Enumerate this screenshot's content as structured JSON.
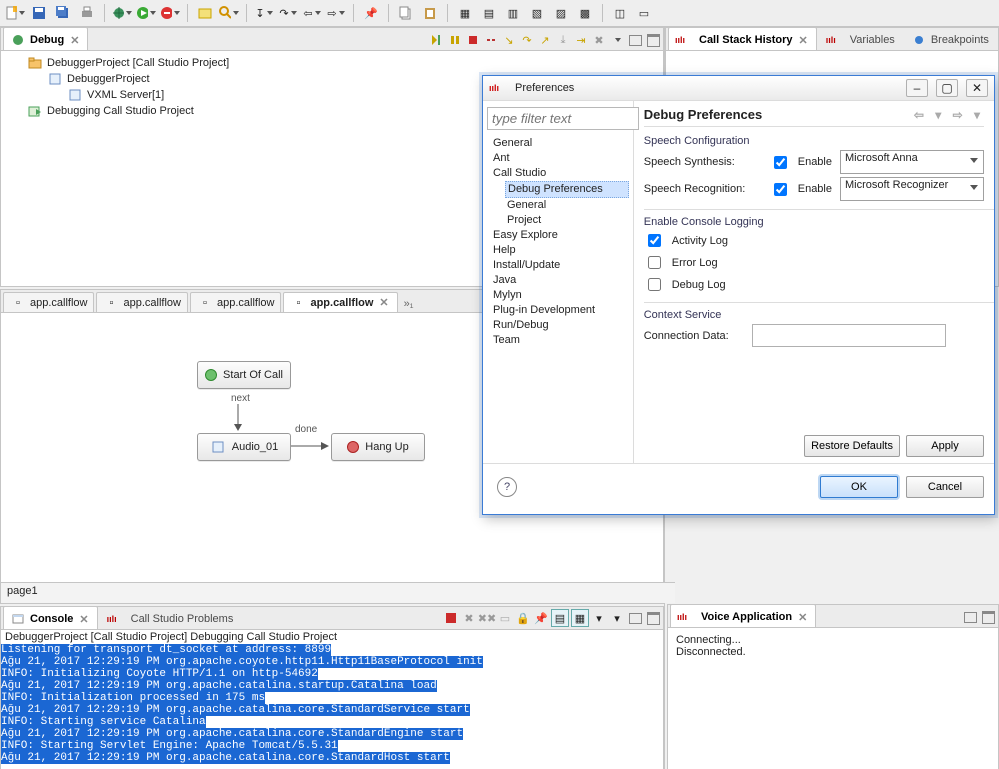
{
  "toolbar": {},
  "debugView": {
    "tab": "Debug",
    "tree": {
      "project": "DebuggerProject [Call Studio Project]",
      "app": "DebuggerProject",
      "server": "VXML Server[1]",
      "debugging": "Debugging Call Studio Project"
    }
  },
  "rightTabs": {
    "stack": "Call Stack History",
    "vars": "Variables",
    "bp": "Breakpoints"
  },
  "editors": {
    "t1": "app.callflow",
    "t2": "app.callflow",
    "t3": "app.callflow",
    "t4": "app.callflow",
    "overflow": "»₁"
  },
  "flow": {
    "start": "Start Of Call",
    "nextLbl": "next",
    "audio": "Audio_01",
    "doneLbl": "done",
    "hang": "Hang Up",
    "page": "page1"
  },
  "bottomTabs": {
    "console": "Console",
    "problems": "Call Studio Problems"
  },
  "console": {
    "header": "DebuggerProject [Call Studio Project] Debugging Call Studio Project",
    "l1": "Listening for transport dt_socket at address: 8899",
    "l2": "Ağu 21, 2017 12:29:19 PM org.apache.coyote.http11.Http11BaseProtocol init",
    "l3": "INFO: Initializing Coyote HTTP/1.1 on http-54692",
    "l4": "Ağu 21, 2017 12:29:19 PM org.apache.catalina.startup.Catalina load",
    "l5": "INFO: Initialization processed in 175 ms",
    "l6": "Ağu 21, 2017 12:29:19 PM org.apache.catalina.core.StandardService start",
    "l7": "INFO: Starting service Catalina",
    "l8": "Ağu 21, 2017 12:29:19 PM org.apache.catalina.core.StandardEngine start",
    "l9": "INFO: Starting Servlet Engine: Apache Tomcat/5.5.31",
    "l10": "Ağu 21, 2017 12:29:19 PM org.apache.catalina.core.StandardHost start"
  },
  "voice": {
    "tab": "Voice Application",
    "l1": "Connecting...",
    "l2": "Disconnected."
  },
  "dialog": {
    "title": "Preferences",
    "filterPlaceholder": "type filter text",
    "tree": {
      "general": "General",
      "ant": "Ant",
      "callstudio": "Call Studio",
      "debugprefs": "Debug Preferences",
      "general2": "General",
      "project": "Project",
      "easy": "Easy Explore",
      "help": "Help",
      "install": "Install/Update",
      "java": "Java",
      "mylyn": "Mylyn",
      "plugin": "Plug-in Development",
      "rundebug": "Run/Debug",
      "team": "Team"
    },
    "heading": "Debug Preferences",
    "speechGroup": "Speech Configuration",
    "synLbl": "Speech Synthesis:",
    "recogLbl": "Speech Recognition:",
    "enableLbl": "Enable",
    "synVal": "Microsoft Anna",
    "recogVal": "Microsoft Recognizer",
    "logGroup": "Enable Console Logging",
    "activity": "Activity Log",
    "errorlog": "Error Log",
    "debuglog": "Debug Log",
    "ctxGroup": "Context Service",
    "connLbl": "Connection Data:",
    "restore": "Restore Defaults",
    "apply": "Apply",
    "ok": "OK",
    "cancel": "Cancel"
  }
}
